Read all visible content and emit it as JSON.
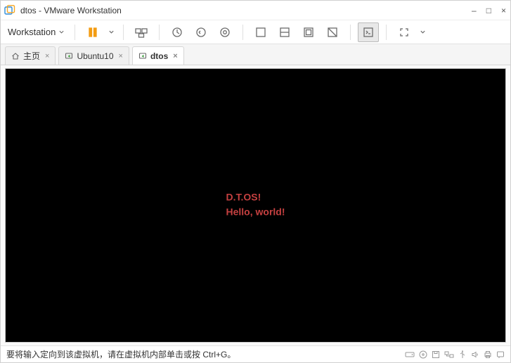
{
  "window": {
    "title": "dtos - VMware Workstation",
    "controls": {
      "minimize": "–",
      "maximize": "□",
      "close": "×"
    }
  },
  "menu": {
    "workstation": "Workstation"
  },
  "tabs": [
    {
      "label": "主页",
      "active": false,
      "icon": "home"
    },
    {
      "label": "Ubuntu10",
      "active": false,
      "icon": "vm"
    },
    {
      "label": "dtos",
      "active": true,
      "icon": "vm"
    }
  ],
  "vm_output": {
    "line1": "D.T.OS!",
    "line2": "Hello, world!"
  },
  "status": {
    "message": "要将输入定向到该虚拟机，请在虚拟机内部单击或按 Ctrl+G。"
  }
}
